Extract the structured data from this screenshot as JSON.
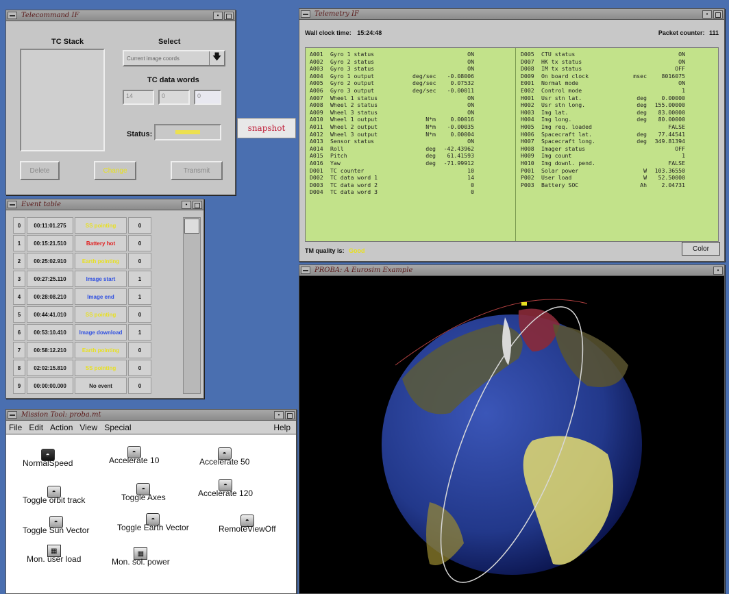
{
  "telecommand": {
    "title": "Telecommand IF",
    "stack_label": "TC Stack",
    "select_label": "Select",
    "select_value": "Current image coords",
    "data_words_label": "TC data words",
    "data_words": [
      "14",
      "0",
      "0"
    ],
    "status_label": "Status:",
    "delete_label": "Delete",
    "change_label": "Change",
    "transmit_label": "Transmit"
  },
  "snapshot_label": "snapshot",
  "event_table": {
    "title": "Event table",
    "rows": [
      {
        "idx": "0",
        "time": "00:11:01.275",
        "name": "SS pointing",
        "count": "0",
        "color": "#e8e020"
      },
      {
        "idx": "1",
        "time": "00:15:21.510",
        "name": "Battery hot",
        "count": "0",
        "color": "#e02020"
      },
      {
        "idx": "2",
        "time": "00:25:02.910",
        "name": "Earth pointing",
        "count": "0",
        "color": "#e8e020"
      },
      {
        "idx": "3",
        "time": "00:27:25.110",
        "name": "Image start",
        "count": "1",
        "color": "#3050e0"
      },
      {
        "idx": "4",
        "time": "00:28:08.210",
        "name": "Image end",
        "count": "1",
        "color": "#3050e0"
      },
      {
        "idx": "5",
        "time": "00:44:41.010",
        "name": "SS pointing",
        "count": "0",
        "color": "#e8e020"
      },
      {
        "idx": "6",
        "time": "00:53:10.410",
        "name": "Image download",
        "count": "1",
        "color": "#3050e0"
      },
      {
        "idx": "7",
        "time": "00:58:12.210",
        "name": "Earth pointing",
        "count": "0",
        "color": "#e8e020"
      },
      {
        "idx": "8",
        "time": "02:02:15.810",
        "name": "SS pointing",
        "count": "0",
        "color": "#e8e020"
      },
      {
        "idx": "9",
        "time": "00:00:00.000",
        "name": "No event",
        "count": "0",
        "color": "#222222"
      }
    ]
  },
  "mission_tool": {
    "title": "Mission Tool: proba.mt",
    "menu": [
      "File",
      "Edit",
      "Action",
      "View",
      "Special"
    ],
    "help": "Help",
    "icons": {
      "normal_speed": "NormalSpeed",
      "accelerate_10": "Accelerate 10",
      "accelerate_50": "Accelerate 50",
      "toggle_orbit": "Toggle orbit track",
      "toggle_axes": "Toggle Axes",
      "accelerate_120": "Accelerate 120",
      "toggle_sun": "Toggle Sun Vector",
      "toggle_earth": "Toggle Earth Vector",
      "remote_view": "RemoteViewOff",
      "mon_user": "Mon. user load",
      "mon_sol": "Mon. sol. power"
    }
  },
  "telemetry": {
    "title": "Telemetry IF",
    "wall_clock_label": "Wall clock time:",
    "wall_clock_value": "15:24:48",
    "packet_counter_label": "Packet counter:",
    "packet_counter_value": "111",
    "quality_label": "TM quality is:",
    "quality_value": "Good",
    "color_button": "Color",
    "left": [
      {
        "id": "A001",
        "name": "Gyro 1 status",
        "unit": "",
        "value": "ON"
      },
      {
        "id": "A002",
        "name": "Gyro 2 status",
        "unit": "",
        "value": "ON"
      },
      {
        "id": "A003",
        "name": "Gyro 3 status",
        "unit": "",
        "value": "ON"
      },
      {
        "id": "A004",
        "name": "Gyro 1 output",
        "unit": "deg/sec",
        "value": "-0.08006"
      },
      {
        "id": "A005",
        "name": "Gyro 2 output",
        "unit": "deg/sec",
        "value": "0.07532"
      },
      {
        "id": "A006",
        "name": "Gyro 3 output",
        "unit": "deg/sec",
        "value": "-0.00011"
      },
      {
        "id": "A007",
        "name": "Wheel 1 status",
        "unit": "",
        "value": "ON"
      },
      {
        "id": "A008",
        "name": "Wheel 2 status",
        "unit": "",
        "value": "ON"
      },
      {
        "id": "A009",
        "name": "Wheel 3 status",
        "unit": "",
        "value": "ON"
      },
      {
        "id": "A010",
        "name": "Wheel 1 output",
        "unit": "N*m",
        "value": "0.00016"
      },
      {
        "id": "A011",
        "name": "Wheel 2 output",
        "unit": "N*m",
        "value": "-0.00035"
      },
      {
        "id": "A012",
        "name": "Wheel 3 output",
        "unit": "N*m",
        "value": "0.00004"
      },
      {
        "id": "A013",
        "name": "Sensor status",
        "unit": "",
        "value": "ON"
      },
      {
        "id": "A014",
        "name": "Roll",
        "unit": "deg",
        "value": "-42.43962"
      },
      {
        "id": "A015",
        "name": "Pitch",
        "unit": "deg",
        "value": "61.41593"
      },
      {
        "id": "A016",
        "name": "Yaw",
        "unit": "deg",
        "value": "-71.99912"
      },
      {
        "id": "D001",
        "name": "TC counter",
        "unit": "",
        "value": "10"
      },
      {
        "id": "D002",
        "name": "TC data word 1",
        "unit": "",
        "value": "14"
      },
      {
        "id": "D003",
        "name": "TC data word 2",
        "unit": "",
        "value": "0"
      },
      {
        "id": "D004",
        "name": "TC data word 3",
        "unit": "",
        "value": "0"
      }
    ],
    "right": [
      {
        "id": "D005",
        "name": "CTU status",
        "unit": "",
        "value": "ON"
      },
      {
        "id": "D007",
        "name": "HK tx status",
        "unit": "",
        "value": "ON"
      },
      {
        "id": "D008",
        "name": "IM tx status",
        "unit": "",
        "value": "OFF"
      },
      {
        "id": "D009",
        "name": "On board clock",
        "unit": "msec",
        "value": "8016075"
      },
      {
        "id": "E001",
        "name": "Normal mode",
        "unit": "",
        "value": "ON"
      },
      {
        "id": "E002",
        "name": "Control mode",
        "unit": "",
        "value": "1"
      },
      {
        "id": "H001",
        "name": "Usr stn lat.",
        "unit": "deg",
        "value": "0.00000"
      },
      {
        "id": "H002",
        "name": "Usr stn long.",
        "unit": "deg",
        "value": "155.00000"
      },
      {
        "id": "H003",
        "name": "Img lat.",
        "unit": "deg",
        "value": "83.00000"
      },
      {
        "id": "H004",
        "name": "Img long.",
        "unit": "deg",
        "value": "80.00000"
      },
      {
        "id": "H005",
        "name": "Img req. loaded",
        "unit": "",
        "value": "FALSE"
      },
      {
        "id": "H006",
        "name": "Spacecraft lat.",
        "unit": "deg",
        "value": "77.44541"
      },
      {
        "id": "H007",
        "name": "Spacecraft long.",
        "unit": "deg",
        "value": "349.81394"
      },
      {
        "id": "H008",
        "name": "Imager status",
        "unit": "",
        "value": "OFF"
      },
      {
        "id": "H009",
        "name": "Img count",
        "unit": "",
        "value": "1"
      },
      {
        "id": "H010",
        "name": "Img downl. pend.",
        "unit": "",
        "value": "FALSE"
      },
      {
        "id": "P001",
        "name": "Solar power",
        "unit": "W",
        "value": "103.36550"
      },
      {
        "id": "P002",
        "name": "User load",
        "unit": "W",
        "value": "52.50000"
      },
      {
        "id": "P003",
        "name": "Battery SOC",
        "unit": "Ah",
        "value": "2.04731"
      }
    ]
  },
  "proba_view": {
    "title": "PROBA: A Eurosim Example"
  },
  "colors": {
    "desktop": "#4a6fb0",
    "telemetry_panel": "#c2e28a",
    "accent_red": "#c0203a",
    "status_good": "#e8e020"
  }
}
